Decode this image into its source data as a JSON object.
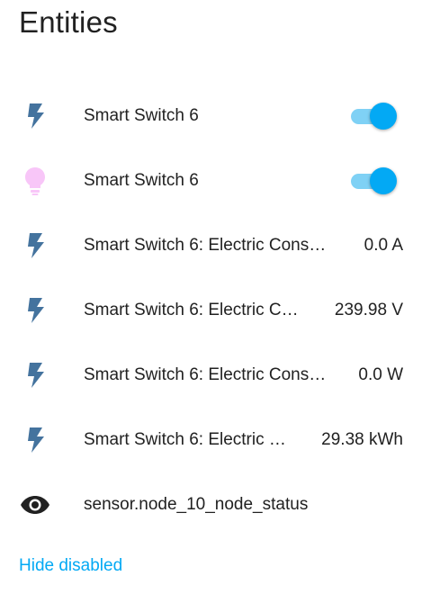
{
  "card": {
    "title": "Entities"
  },
  "colors": {
    "accent": "#03a9f4",
    "icon": "#44739e",
    "bulb_on": "#f8c6f8"
  },
  "entities": [
    {
      "icon": "flash-icon",
      "name": "Smart Switch 6",
      "toggle_on": true
    },
    {
      "icon": "lightbulb-icon",
      "name": "Smart Switch 6",
      "toggle_on": true
    },
    {
      "icon": "flash-icon",
      "name": "Smart Switch 6: Electric Cons…",
      "value": "0.0 A"
    },
    {
      "icon": "flash-icon",
      "name": "Smart Switch 6: Electric C…",
      "value": "239.98 V"
    },
    {
      "icon": "flash-icon",
      "name": "Smart Switch 6: Electric Cons…",
      "value": "0.0 W"
    },
    {
      "icon": "flash-icon",
      "name": "Smart Switch 6: Electric …",
      "value": "29.38 kWh"
    },
    {
      "icon": "eye-icon",
      "name": "sensor.node_10_node_status"
    }
  ],
  "footer": {
    "hide_disabled_label": "Hide disabled"
  }
}
